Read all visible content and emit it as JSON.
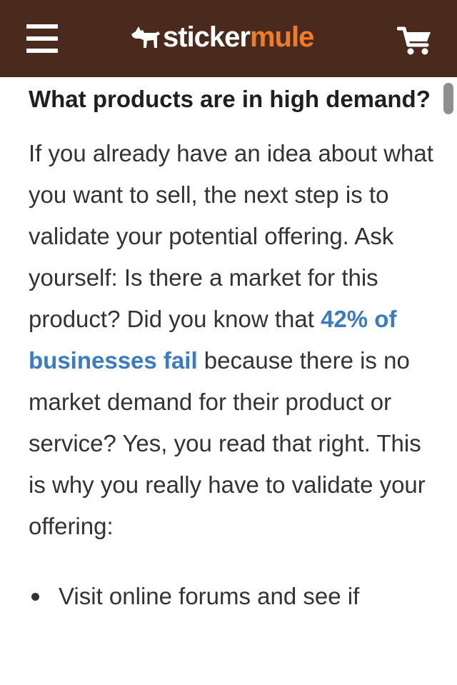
{
  "header": {
    "brand_part1": "sticker",
    "brand_part2": "mule",
    "icons": [
      "hamburger-menu-icon",
      "mule-logo-icon",
      "shopping-cart-icon"
    ],
    "colors": {
      "background": "#4a2a1c",
      "brand_white": "#ffffff",
      "brand_orange": "#f27b26"
    }
  },
  "article": {
    "heading": "What products are in high demand?",
    "paragraph_before_link": "If you already have an idea about what you want to sell, the next step is to validate your potential offering. Ask yourself: Is there a market for this product? Did you know that ",
    "link_text": "42% of businesses fail",
    "paragraph_after_link": " because there is no market demand for their product or service? Yes, you read that right. This is why you really have to validate your offering:",
    "bullets": [
      "Visit online forums and see if"
    ],
    "colors": {
      "link": "#3a7bc3",
      "text": "#333333"
    }
  }
}
